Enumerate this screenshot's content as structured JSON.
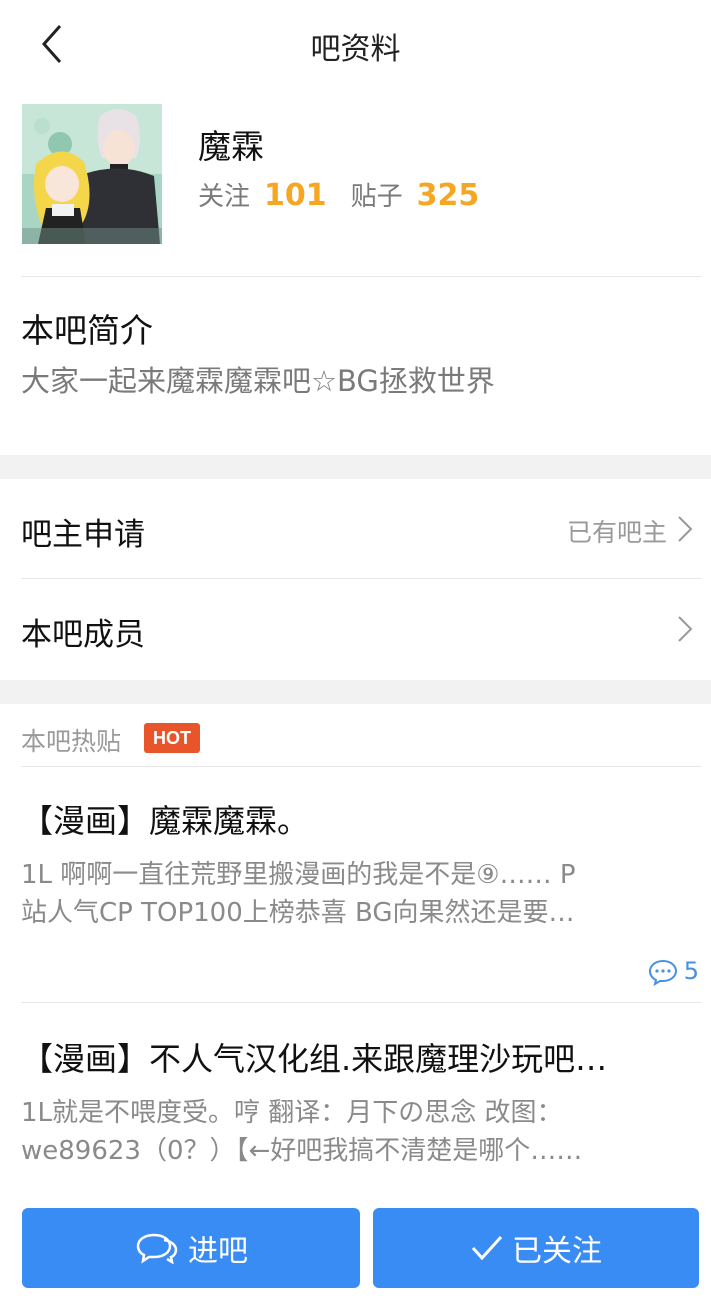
{
  "header": {
    "title": "吧资料"
  },
  "forum": {
    "name": "魔霖",
    "follow_label": "关注",
    "follow_count": "101",
    "posts_label": "贴子",
    "posts_count": "325"
  },
  "intro": {
    "title": "本吧简介",
    "text": "大家一起来魔霖魔霖吧☆BG拯救世界"
  },
  "rows": [
    {
      "label": "吧主申请",
      "value": "已有吧主"
    },
    {
      "label": "本吧成员",
      "value": ""
    }
  ],
  "hot_posts": {
    "header": "本吧热贴",
    "badge": "HOT",
    "items": [
      {
        "title": "【漫画】魔霖魔霖。",
        "abstract_line1": "1L 啊啊一直往荒野里搬漫画的我是不是⑨…… P",
        "abstract_line2": "站人气CP TOP100上榜恭喜 BG向果然还是要…",
        "comments": "5"
      },
      {
        "title": "【漫画】不人气汉化组.来跟魔理沙玩吧…",
        "abstract_line1": "1L就是不喂度受。哼 翻译：月下の思念 改图：",
        "abstract_line2": "we89623（0？）【←好吧我搞不清楚是哪个……"
      }
    ]
  },
  "buttons": {
    "enter": "进吧",
    "followed": "已关注"
  },
  "colors": {
    "accent": "#3a8cf5",
    "stat_number": "#f5a623",
    "hot_badge": "#e9552a"
  }
}
